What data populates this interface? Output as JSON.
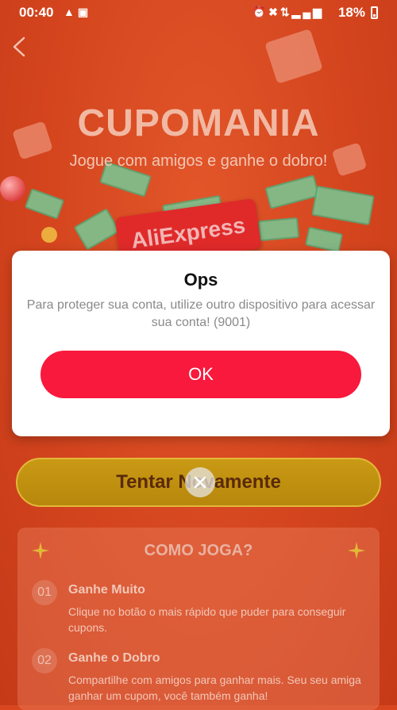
{
  "status_bar": {
    "time": "00:40",
    "left_icons": [
      "notification-icon",
      "screencast-icon"
    ],
    "right_icons": [
      "alarm-icon",
      "mute-icon",
      "data-icon",
      "signal-icon"
    ],
    "battery_percent": "18%"
  },
  "game": {
    "title": "CUPOMANIA",
    "subtitle": "Jogue com amigos e ganhe o dobro!",
    "brand": "AliExpress",
    "retry_label": "Tentar Novamente"
  },
  "modal": {
    "title": "Ops",
    "message": "Para proteger sua conta, utilize outro dispositivo para acessar sua conta! (9001)",
    "ok_label": "OK",
    "ok_color": "#f8193c"
  },
  "howto": {
    "title": "COMO JOGA?",
    "steps": [
      {
        "num": "01",
        "title": "Ganhe Muito",
        "desc": "Clique no botão o mais rápido que puder para conseguir cupons."
      },
      {
        "num": "02",
        "title": "Ganhe o Dobro",
        "desc": "Compartilhe com amigos para ganhar mais. Seu seu amiga ganhar um cupom, você também ganha!"
      }
    ]
  },
  "colors": {
    "background": "#d8471f",
    "gold": "#c99a14"
  }
}
